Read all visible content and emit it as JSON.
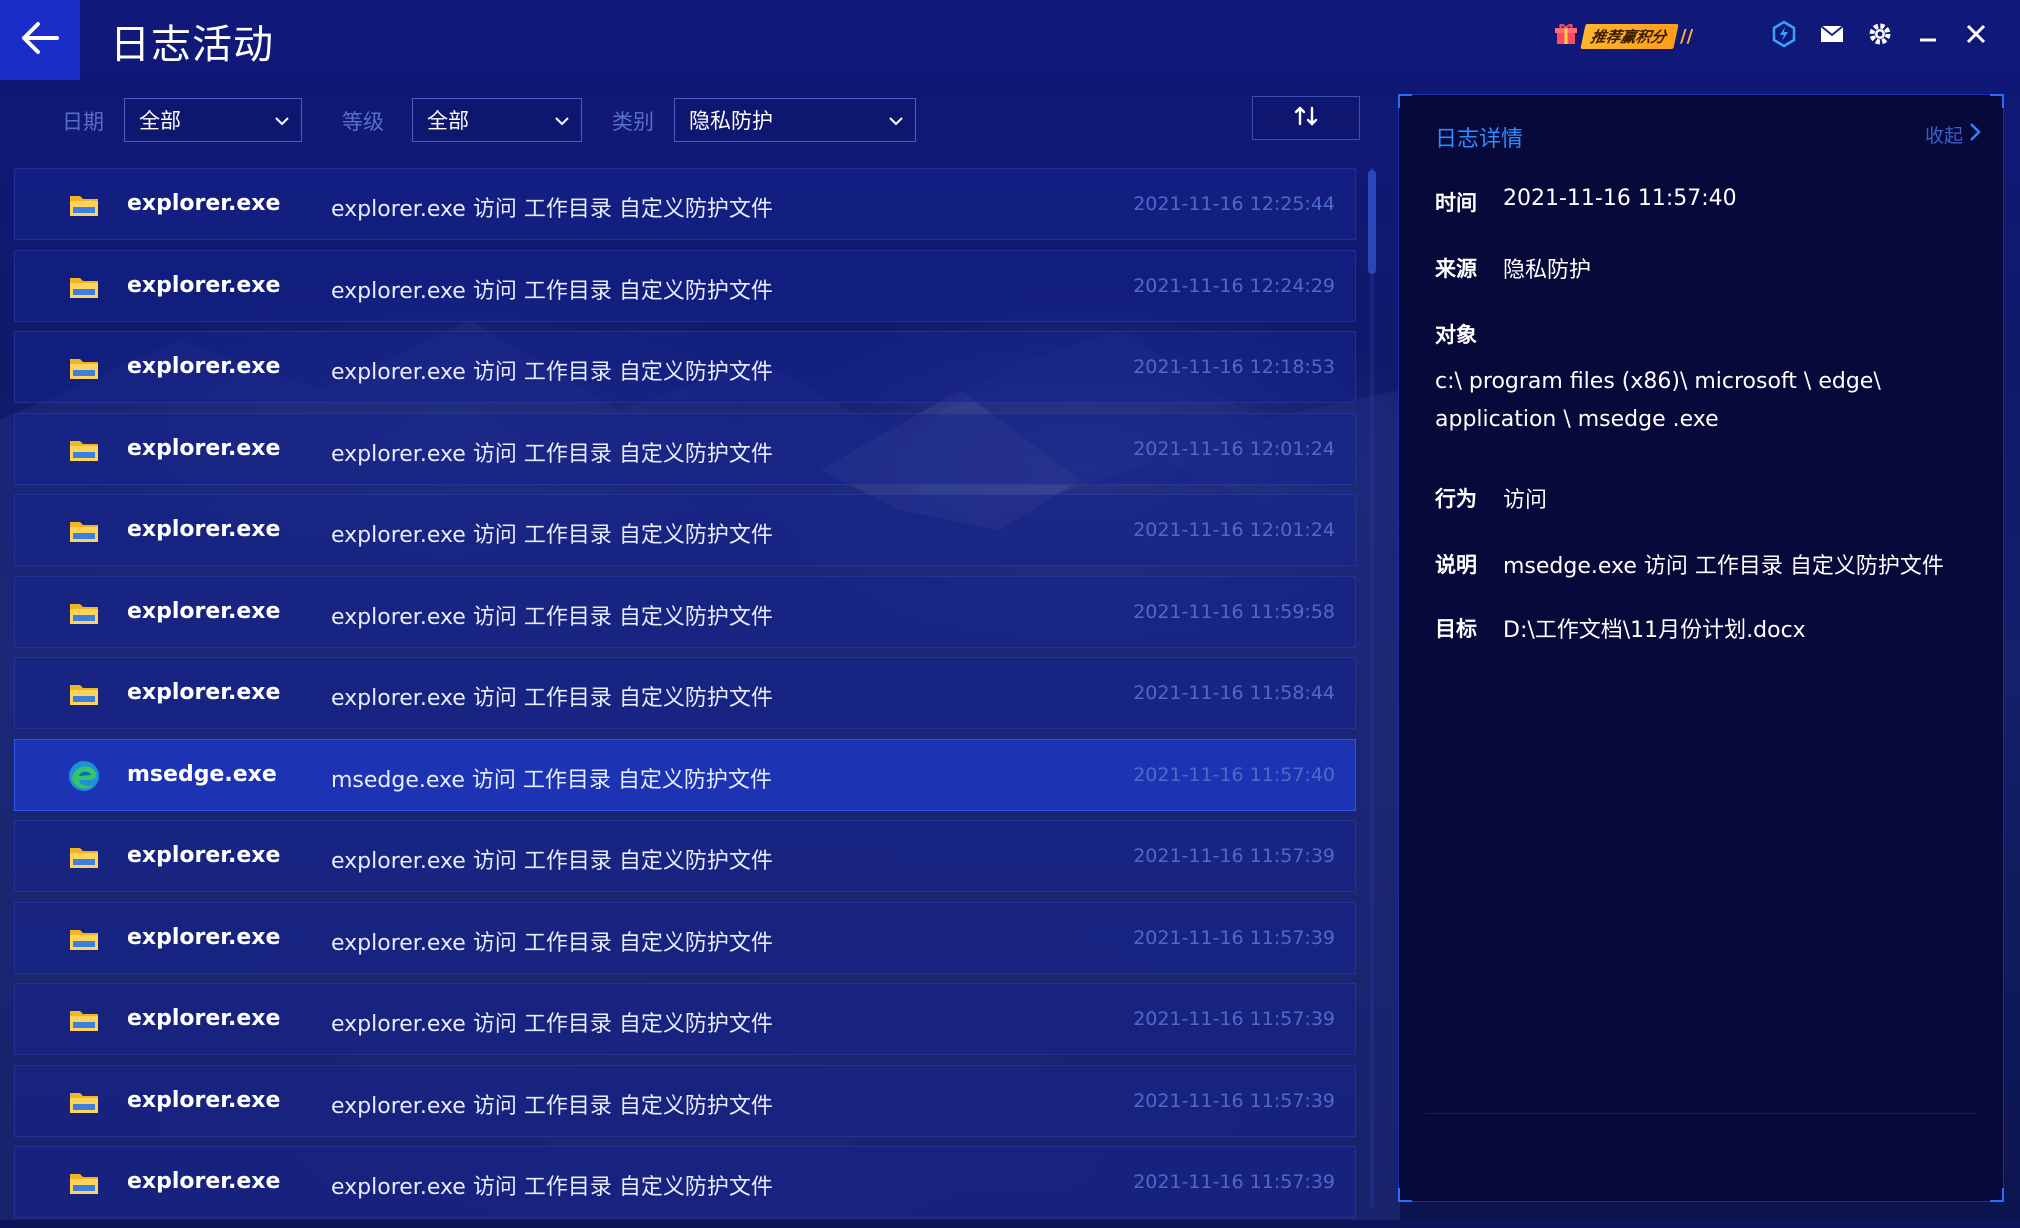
{
  "header": {
    "title": "日志活动",
    "promo_label": "推荐赢积分"
  },
  "filters": {
    "date_label": "日期",
    "date_value": "全部",
    "level_label": "等级",
    "level_value": "全部",
    "category_label": "类别",
    "category_value": "隐私防护"
  },
  "log_rows": [
    {
      "icon": "folder-icon",
      "name": "explorer.exe",
      "desc": "explorer.exe 访问 工作目录 自定义防护文件",
      "time": "2021-11-16 12:25:44"
    },
    {
      "icon": "folder-icon",
      "name": "explorer.exe",
      "desc": "explorer.exe 访问 工作目录 自定义防护文件",
      "time": "2021-11-16 12:24:29"
    },
    {
      "icon": "folder-icon",
      "name": "explorer.exe",
      "desc": "explorer.exe 访问 工作目录 自定义防护文件",
      "time": "2021-11-16 12:18:53"
    },
    {
      "icon": "folder-icon",
      "name": "explorer.exe",
      "desc": "explorer.exe 访问 工作目录 自定义防护文件",
      "time": "2021-11-16 12:01:24"
    },
    {
      "icon": "folder-icon",
      "name": "explorer.exe",
      "desc": "explorer.exe 访问 工作目录 自定义防护文件",
      "time": "2021-11-16 12:01:24"
    },
    {
      "icon": "folder-icon",
      "name": "explorer.exe",
      "desc": "explorer.exe 访问 工作目录 自定义防护文件",
      "time": "2021-11-16 11:59:58"
    },
    {
      "icon": "folder-icon",
      "name": "explorer.exe",
      "desc": "explorer.exe 访问 工作目录 自定义防护文件",
      "time": "2021-11-16 11:58:44"
    },
    {
      "icon": "edge-icon",
      "name": "msedge.exe",
      "desc": "msedge.exe 访问 工作目录 自定义防护文件",
      "time": "2021-11-16 11:57:40",
      "selected": true
    },
    {
      "icon": "folder-icon",
      "name": "explorer.exe",
      "desc": "explorer.exe 访问 工作目录 自定义防护文件",
      "time": "2021-11-16 11:57:39"
    },
    {
      "icon": "folder-icon",
      "name": "explorer.exe",
      "desc": "explorer.exe 访问 工作目录 自定义防护文件",
      "time": "2021-11-16 11:57:39"
    },
    {
      "icon": "folder-icon",
      "name": "explorer.exe",
      "desc": "explorer.exe 访问 工作目录 自定义防护文件",
      "time": "2021-11-16 11:57:39"
    },
    {
      "icon": "folder-icon",
      "name": "explorer.exe",
      "desc": "explorer.exe 访问 工作目录 自定义防护文件",
      "time": "2021-11-16 11:57:39"
    },
    {
      "icon": "folder-icon",
      "name": "explorer.exe",
      "desc": "explorer.exe 访问 工作目录 自定义防护文件",
      "time": "2021-11-16 11:57:39"
    }
  ],
  "detail": {
    "title": "日志详情",
    "collapse_label": "收起",
    "time_label": "时间",
    "time_value": "2021-11-16 11:57:40",
    "source_label": "来源",
    "source_value": "隐私防护",
    "object_label": "对象",
    "object_value": "c:\\ program   files (x86)\\ microsoft \\ edge\\  application \\ msedge .exe",
    "action_label": "行为",
    "action_value": "访问",
    "desc_label": "说明",
    "desc_value": "msedge.exe 访问 工作目录 自定义防护文件",
    "target_label": "目标",
    "target_value": "D:\\工作文档\\11月份计划.docx"
  },
  "colors": {
    "accent": "#2d8cff",
    "back_button": "#1b2dc8",
    "selected_row": "#1c37be",
    "timestamp": "#4f69c8",
    "promo": "#ffb52b"
  }
}
